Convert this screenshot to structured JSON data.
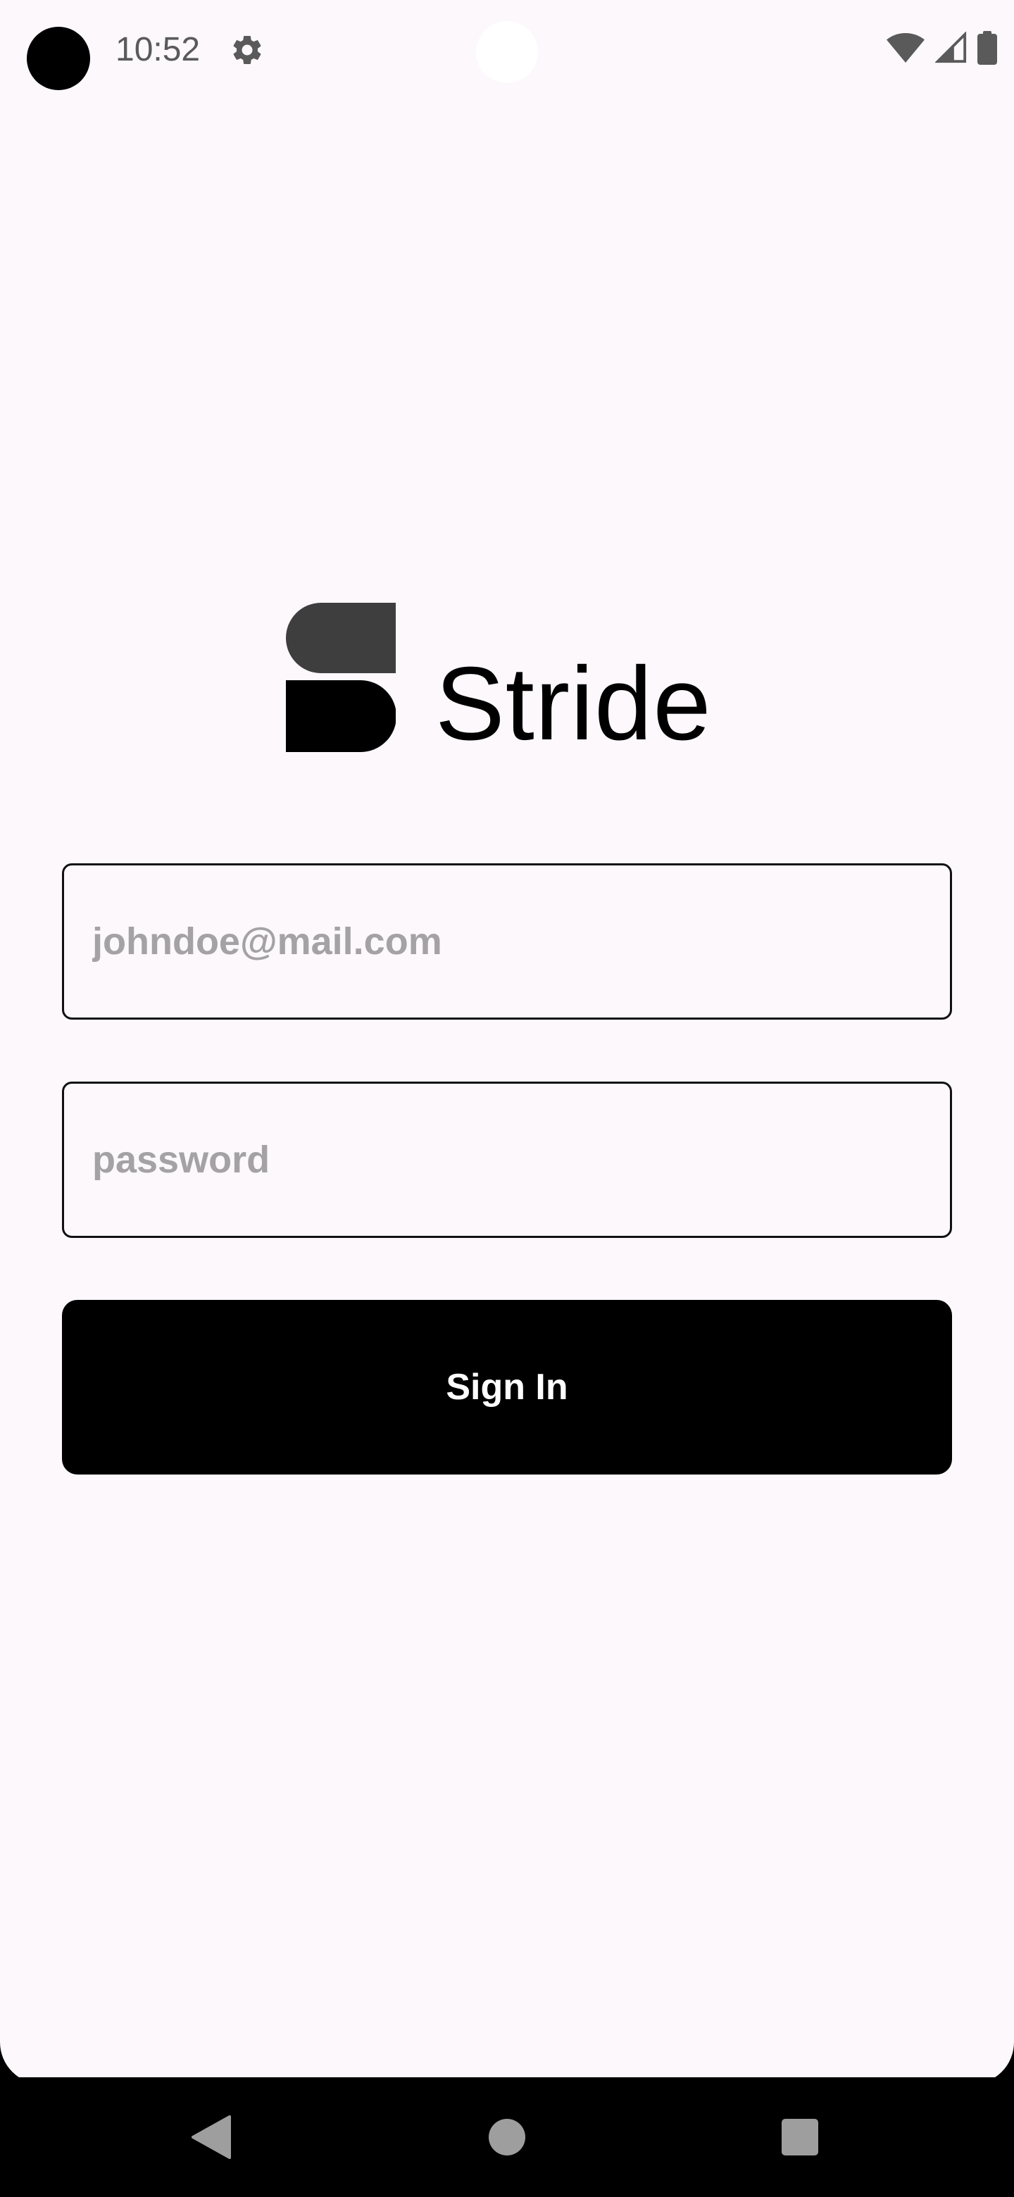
{
  "status_bar": {
    "time": "10:52",
    "icons": [
      "settings-icon",
      "wifi-icon",
      "signal-icon",
      "battery-icon"
    ]
  },
  "brand": {
    "name": "Stride",
    "logo_icon": "stride-logo-icon"
  },
  "form": {
    "email_placeholder": "johndoe@mail.com",
    "password_placeholder": "password",
    "submit_label": "Sign In"
  },
  "nav_bar": {
    "buttons": [
      "back-icon",
      "home-icon",
      "recents-icon"
    ]
  },
  "colors": {
    "background": "#fcf8fb",
    "primary": "#000000",
    "placeholder": "#a4a2a4",
    "logo_top": "#3e3e3e"
  }
}
